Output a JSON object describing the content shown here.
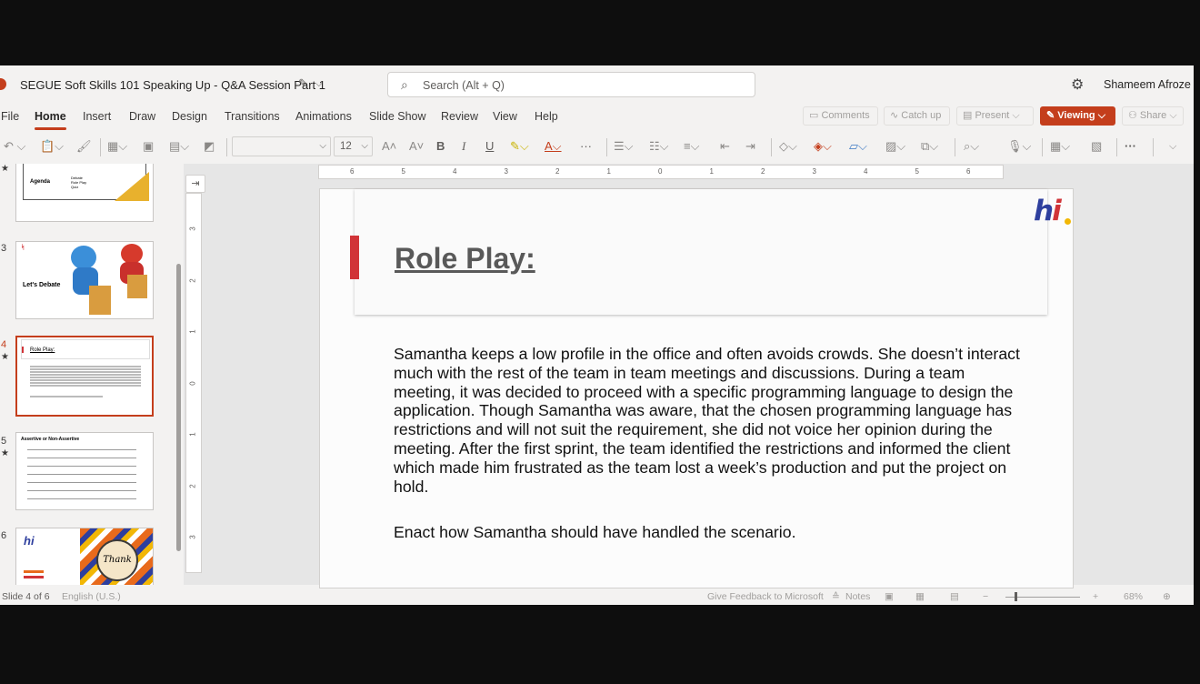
{
  "app": {
    "title": "SEGUE Soft Skills 101 Speaking Up - Q&A Session Part 1",
    "search_placeholder": "Search (Alt + Q)",
    "user": "Shameem Afroze"
  },
  "ribbon": {
    "tabs": [
      "File",
      "Home",
      "Insert",
      "Draw",
      "Design",
      "Transitions",
      "Animations",
      "Slide Show",
      "Review",
      "View",
      "Help"
    ],
    "active_tab": "Home",
    "comments": "Comments",
    "catch_up": "Catch up",
    "present": "Present",
    "viewing": "Viewing",
    "share": "Share"
  },
  "toolbar": {
    "font_size": "12",
    "bold": "B",
    "italic": "I",
    "underline": "U",
    "more": "···"
  },
  "thumbnails": [
    {
      "num": "",
      "title": "Agenda",
      "bullets": [
        "Debate",
        "Role Play",
        "Quiz"
      ]
    },
    {
      "num": "3",
      "title": "Let's Debate"
    },
    {
      "num": "4",
      "title": "Role Play:",
      "selected": true
    },
    {
      "num": "5",
      "title": "Assertive or Non-Assertive"
    },
    {
      "num": "6",
      "title": "Thank you"
    }
  ],
  "ruler": {
    "h_labels": [
      "6",
      "5",
      "4",
      "3",
      "2",
      "1",
      "0",
      "1",
      "2",
      "3",
      "4",
      "5",
      "6"
    ],
    "v_labels": [
      "3",
      "2",
      "1",
      "0",
      "1",
      "2",
      "3"
    ]
  },
  "slide": {
    "title": "Role Play:",
    "logo": "hi",
    "body": "Samantha keeps a low profile in the office and often avoids crowds. She doesn’t interact much with the rest of the team in team meetings and discussions. During a team meeting, it was decided to proceed with a specific programming language to design the application. Though Samantha was aware, that the chosen programming language has restrictions and will not suit the requirement, she did not voice her opinion during the meeting. After the first sprint, the team identified the restrictions and informed the client which made him frustrated as the team lost a week’s production and put the project on hold.",
    "prompt": "Enact how Samantha should have handled the scenario."
  },
  "status": {
    "slide": "Slide 4 of 6",
    "language": "English (U.S.)",
    "feedback": "Give Feedback to Microsoft",
    "notes": "Notes",
    "zoom": "68%"
  },
  "colors": {
    "accent": "#c43e1c",
    "red_bar": "#d13438",
    "logo_blue": "#2e3f9e"
  }
}
